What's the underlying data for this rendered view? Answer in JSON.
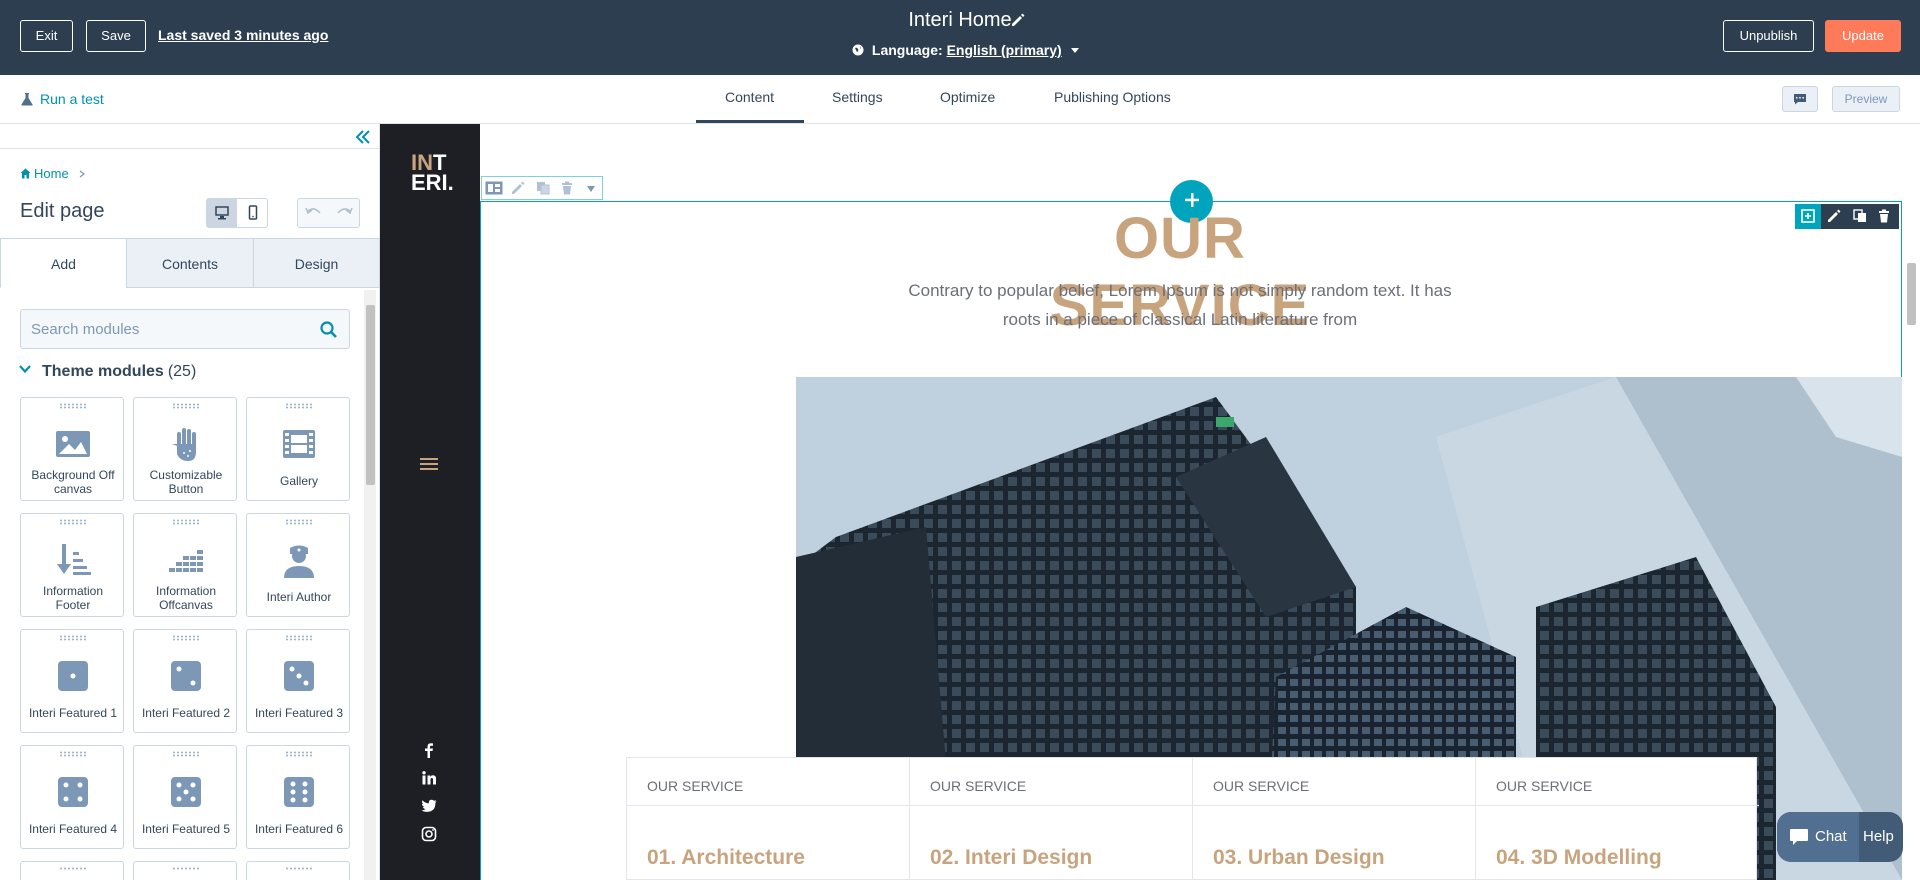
{
  "topbar": {
    "exit_label": "Exit",
    "save_label": "Save",
    "last_saved": "Last saved 3 minutes ago",
    "page_title": "Interi Home",
    "language_prefix": "Language:",
    "language_value": "English (primary)",
    "unpublish_label": "Unpublish",
    "update_label": "Update"
  },
  "subbar": {
    "run_test": "Run a test",
    "tabs": [
      {
        "label": "Content"
      },
      {
        "label": "Settings"
      },
      {
        "label": "Optimize"
      },
      {
        "label": "Publishing Options"
      }
    ],
    "active_tab": "Content",
    "preview_label": "Preview"
  },
  "left_panel": {
    "breadcrumb": "Home",
    "title": "Edit page",
    "tabs": [
      {
        "label": "Add"
      },
      {
        "label": "Contents"
      },
      {
        "label": "Design"
      }
    ],
    "search_placeholder": "Search modules",
    "section_title": "Theme modules",
    "section_count": "(25)",
    "modules": [
      {
        "label": "Background Off canvas",
        "icon": "image-icon"
      },
      {
        "label": "Customizable Button",
        "icon": "hand-icon"
      },
      {
        "label": "Gallery",
        "icon": "film-icon"
      },
      {
        "label": "Information Footer",
        "icon": "sort-icon"
      },
      {
        "label": "Information Offcanvas",
        "icon": "bars-icon"
      },
      {
        "label": "Interi Author",
        "icon": "user-icon"
      },
      {
        "label": "Interi Featured 1",
        "icon": "dice-1-icon"
      },
      {
        "label": "Interi Featured 2",
        "icon": "dice-2-icon"
      },
      {
        "label": "Interi Featured 3",
        "icon": "dice-3-icon"
      },
      {
        "label": "Interi Featured 4",
        "icon": "dice-4-icon"
      },
      {
        "label": "Interi Featured 5",
        "icon": "dice-5-icon"
      },
      {
        "label": "Interi Featured 6",
        "icon": "dice-6-icon"
      }
    ]
  },
  "site": {
    "logo_line1_a": "IN",
    "logo_line1_b": "T",
    "logo_line2": "ERI.",
    "service_title": "OUR SERVICE",
    "service_desc_line1": "Contrary to popular belief, Lorem Ipsum is not simply random text. It has",
    "service_desc_line2": "roots in a piece of classical Latin literature from",
    "cards": [
      {
        "label": "OUR SERVICE",
        "title": "01. Architecture"
      },
      {
        "label": "OUR SERVICE",
        "title": "02. Interi Design"
      },
      {
        "label": "OUR SERVICE",
        "title": "03. Urban Design"
      },
      {
        "label": "OUR SERVICE",
        "title": "04. 3D Modelling"
      }
    ]
  },
  "chat": {
    "chat_label": "Chat",
    "help_label": "Help"
  },
  "colors": {
    "topbar": "#2d3e50",
    "accent": "#0091ae",
    "update": "#ff7a59",
    "gold": "#c8a47e",
    "outline": "#00a4bd"
  }
}
